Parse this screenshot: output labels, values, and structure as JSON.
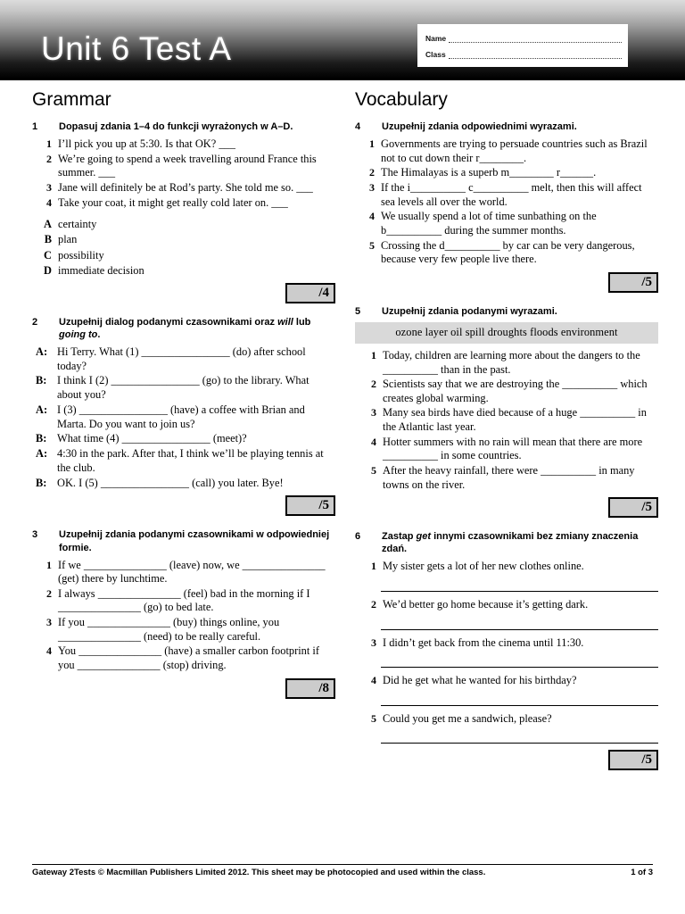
{
  "header": {
    "title": "Unit 6 Test A",
    "name_label": "Name",
    "class_label": "Class"
  },
  "columns": {
    "left_title": "Grammar",
    "right_title": "Vocabulary"
  },
  "exercises": [
    {
      "number": "1",
      "instruction": "Dopasuj zdania 1–4 do funkcji wyrażonych w A–D.",
      "items": [
        {
          "num": "1",
          "text": "I’ll pick you up at 5:30. Is that OK? ___"
        },
        {
          "num": "2",
          "text": "We’re going to spend a week travelling around France this summer. ___"
        },
        {
          "num": "3",
          "text": "Jane will definitely be at Rod’s party. She told me so. ___"
        },
        {
          "num": "4",
          "text": "Take your coat, it might get really cold later on. ___"
        }
      ],
      "options": [
        {
          "letter": "A",
          "text": "certainty"
        },
        {
          "letter": "B",
          "text": "plan"
        },
        {
          "letter": "C",
          "text": "possibility"
        },
        {
          "letter": "D",
          "text": "immediate decision"
        }
      ],
      "score": "/4"
    },
    {
      "number": "2",
      "instruction_pre": "Uzupełnij dialog podanymi czasownikami oraz ",
      "instruction_em1": "will",
      "instruction_mid": " lub ",
      "instruction_em2": "going to",
      "instruction_post": ".",
      "dialogue": [
        {
          "speaker": "A:",
          "text": "Hi Terry. What (1) ________________ (do) after school today?"
        },
        {
          "speaker": "B:",
          "text": "I think I (2) ________________ (go) to the library. What about you?"
        },
        {
          "speaker": "A:",
          "text": "I (3) ________________ (have) a coffee with Brian and Marta. Do you want to join us?"
        },
        {
          "speaker": "B:",
          "text": "What time (4) ________________ (meet)?"
        },
        {
          "speaker": "A:",
          "text": "4:30 in the park. After that, I think we’ll be playing tennis at the club."
        },
        {
          "speaker": "B:",
          "text": "OK. I (5) ________________ (call) you later. Bye!"
        }
      ],
      "score": "/5"
    },
    {
      "number": "3",
      "instruction": "Uzupełnij zdania podanymi czasownikami w odpowiedniej formie.",
      "items": [
        {
          "num": "1",
          "text": "If we _______________ (leave) now, we _______________ (get) there by lunchtime."
        },
        {
          "num": "2",
          "text": "I always _______________ (feel) bad in the morning if I _______________ (go) to bed late."
        },
        {
          "num": "3",
          "text": "If you _______________ (buy) things online, you _______________ (need) to be really careful."
        },
        {
          "num": "4",
          "text": "You _______________ (have) a smaller carbon footprint if you _______________ (stop) driving."
        }
      ],
      "score": "/8"
    },
    {
      "number": "4",
      "instruction": "Uzupełnij zdania odpowiednimi wyrazami.",
      "items": [
        {
          "num": "1",
          "text": "Governments are trying to persuade countries such as Brazil not to cut down their r________."
        },
        {
          "num": "2",
          "text": "The Himalayas is a superb m________ r______."
        },
        {
          "num": "3",
          "text": "If the i__________ c__________ melt, then this will affect sea levels all over the world."
        },
        {
          "num": "4",
          "text": "We usually spend a lot of time sunbathing on the b__________ during the summer months."
        },
        {
          "num": "5",
          "text": "Crossing the d__________ by car can be very dangerous, because very few people live there."
        }
      ],
      "score": "/5"
    },
    {
      "number": "5",
      "instruction": "Uzupełnij zdania podanymi wyrazami.",
      "wordbank": "ozone layer  oil spill  droughts  floods  environment",
      "items": [
        {
          "num": "1",
          "text": "Today, children are learning more about the dangers to the __________ than in the past."
        },
        {
          "num": "2",
          "text": "Scientists say that we are destroying the __________ which creates global warming."
        },
        {
          "num": "3",
          "text": "Many sea birds have died because of a huge __________ in the Atlantic last year."
        },
        {
          "num": "4",
          "text": "Hotter summers with no rain will mean that there are more __________ in some countries."
        },
        {
          "num": "5",
          "text": "After the heavy rainfall, there were __________ in many towns on the river."
        }
      ],
      "score": "/5"
    },
    {
      "number": "6",
      "instruction_pre": "Zastap ",
      "instruction_em1": "get",
      "instruction_post": " innymi czasownikami bez zmiany znaczenia zdań.",
      "items": [
        {
          "num": "1",
          "text": "My sister gets a lot of her new clothes online."
        },
        {
          "num": "2",
          "text": "We’d better go home because it’s getting dark."
        },
        {
          "num": "3",
          "text": "I didn’t get back from the cinema until 11:30."
        },
        {
          "num": "4",
          "text": "Did he get what he wanted for his birthday?"
        },
        {
          "num": "5",
          "text": "Could you get me a sandwich, please?"
        }
      ],
      "score": "/5"
    }
  ],
  "footer": {
    "copyright": "Gateway  2Tests © Macmillan Publishers Limited 2012. This sheet may be photocopied and used within the class.",
    "page": "1 of 3"
  }
}
